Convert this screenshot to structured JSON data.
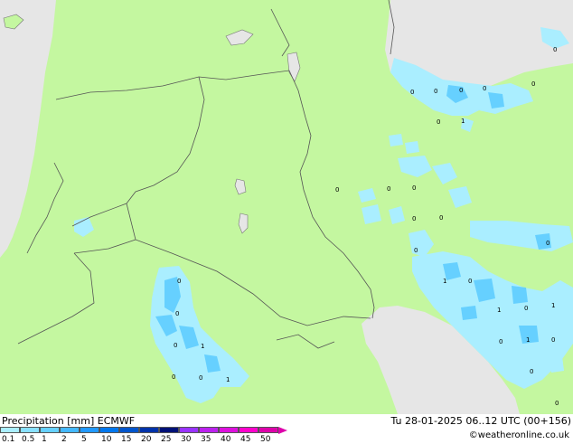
{
  "title": "Precipitation [mm] ECMWF",
  "datetime": "Tu 28-01-2025 06..12 UTC (00+156)",
  "credit": "©weatheronline.co.uk",
  "legend": {
    "ticks": [
      "0.1",
      "0.5",
      "1",
      "2",
      "5",
      "10",
      "15",
      "20",
      "25",
      "30",
      "35",
      "40",
      "45",
      "50"
    ],
    "colors": [
      "#aaeeff",
      "#88e0ff",
      "#66d0ff",
      "#44b8ff",
      "#2299ff",
      "#0077ee",
      "#0055cc",
      "#0033aa",
      "#001177",
      "#9933ff",
      "#bb22ee",
      "#dd11dd",
      "#ff00cc",
      "#dd00aa"
    ]
  },
  "colors": {
    "land": "#c4f7a0",
    "sea": "#e6e6e6",
    "border": "#555555",
    "precip_light": "#aaeeff",
    "precip_medium": "#66d0ff",
    "precip_heavy": "#2299ff"
  },
  "values": [
    "0",
    "0",
    "0",
    "0",
    "0",
    "0",
    "1",
    "0",
    "0",
    "0",
    "0",
    "0",
    "0",
    "0",
    "0",
    "1",
    "0",
    "1",
    "0",
    "1",
    "0",
    "1",
    "0",
    "0",
    "0",
    "0",
    "0",
    "0",
    "1",
    "0",
    "1",
    "0",
    "0"
  ]
}
